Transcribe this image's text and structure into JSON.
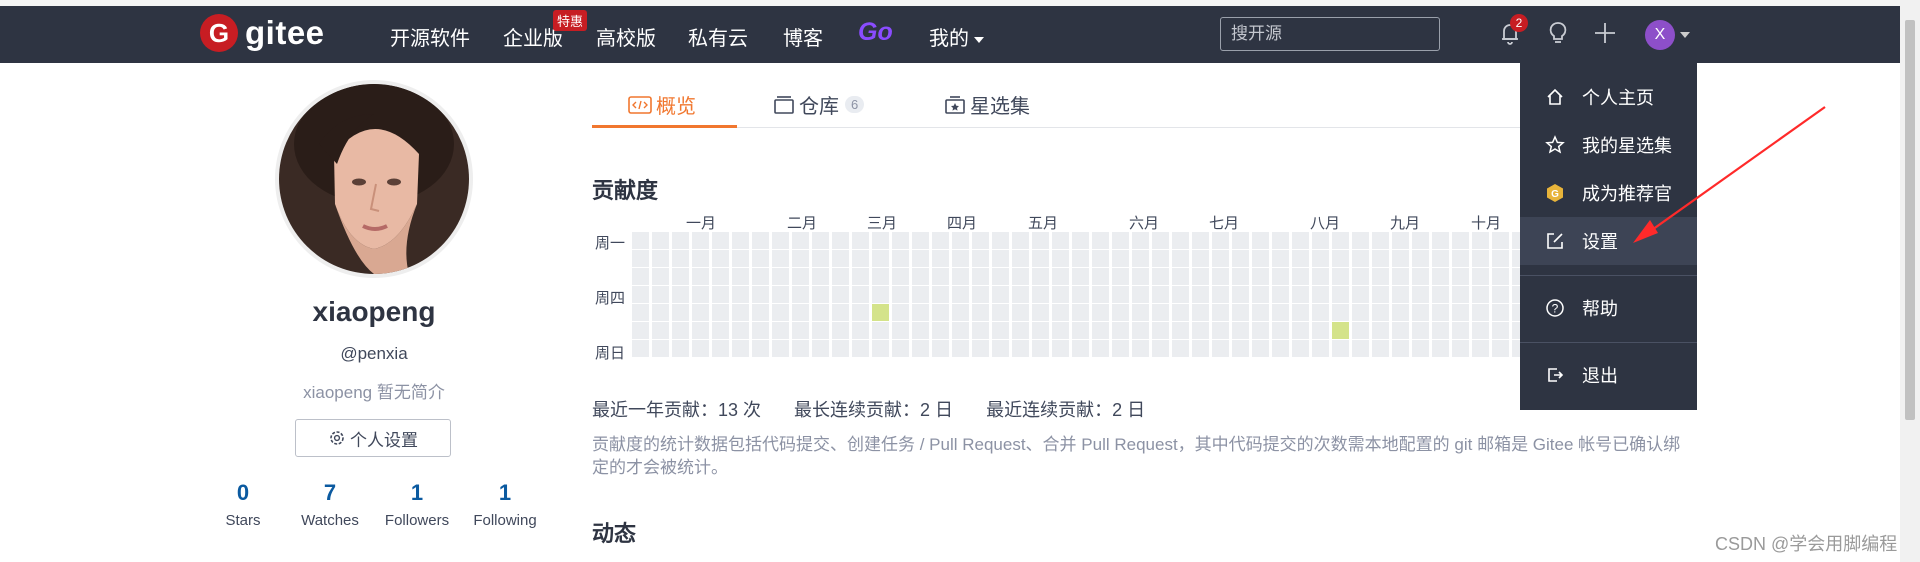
{
  "brand": {
    "logo_letter": "G",
    "name": "gitee"
  },
  "nav": {
    "items": [
      "开源软件",
      "企业版",
      "高校版",
      "私有云",
      "博客"
    ],
    "badge": "特惠",
    "go": "Go",
    "mine": "我的"
  },
  "search": {
    "placeholder": "搜开源"
  },
  "header": {
    "notification_count": "2",
    "avatar_letter": "X"
  },
  "profile": {
    "name": "xiaopeng",
    "handle": "@penxia",
    "bio": "xiaopeng 暂无简介",
    "settings_label": "个人设置",
    "stats": [
      {
        "value": "0",
        "label": "Stars"
      },
      {
        "value": "7",
        "label": "Watches"
      },
      {
        "value": "1",
        "label": "Followers"
      },
      {
        "value": "1",
        "label": "Following"
      }
    ]
  },
  "tabs": {
    "overview": "概览",
    "repos": "仓库",
    "repos_count": "6",
    "collections": "星选集"
  },
  "contrib": {
    "title": "贡献度",
    "months": [
      "一月",
      "二月",
      "三月",
      "四月",
      "五月",
      "六月",
      "七月",
      "八月",
      "九月",
      "十月"
    ],
    "days": [
      "周一",
      "周四",
      "周日"
    ],
    "summary": [
      "最近一年贡献：13 次",
      "最长连续贡献：2 日",
      "最近连续贡献：2 日"
    ],
    "note": "贡献度的统计数据包括代码提交、创建任务 / Pull Request、合并 Pull Request，其中代码提交的次数需本地配置的 git 邮箱是 Gitee 帐号已确认绑定的才会被统计。"
  },
  "activity": {
    "title": "动态"
  },
  "dropdown": {
    "items": [
      {
        "label": "个人主页",
        "icon": "home-icon"
      },
      {
        "label": "我的星选集",
        "icon": "star-icon"
      },
      {
        "label": "成为推荐官",
        "icon": "gitee-badge-icon"
      },
      {
        "label": "设置",
        "icon": "edit-icon"
      },
      {
        "label": "帮助",
        "icon": "help-icon"
      },
      {
        "label": "退出",
        "icon": "logout-icon"
      }
    ]
  },
  "watermark": "CSDN @学会用脚编程",
  "colors": {
    "brand": "#c71d23",
    "accent": "#f1772f",
    "nav_bg": "#2e3442",
    "cell_empty": "#ebedf0",
    "cell_on": "#d4e38a",
    "arrow": "#ff2a2a"
  }
}
